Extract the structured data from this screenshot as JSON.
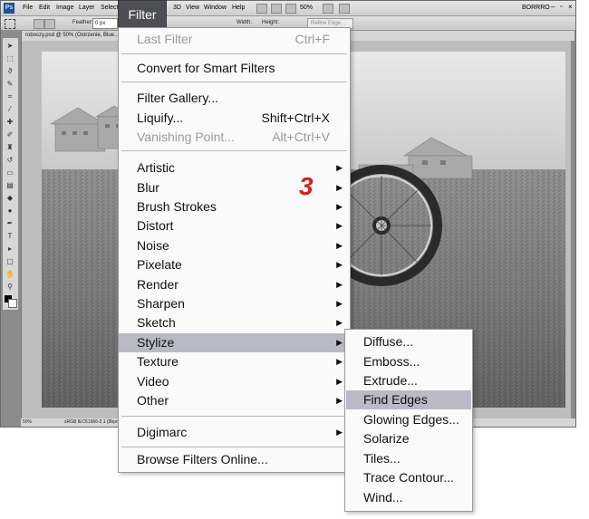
{
  "menubar": {
    "logo": "Ps",
    "items": [
      "File",
      "Edit",
      "Image",
      "Layer",
      "Select",
      "3D",
      "View",
      "Window",
      "Help"
    ],
    "zoom": "50%",
    "workspace": "BORRRO"
  },
  "options": {
    "feather_label": "Feather:",
    "feather_value": "0 px",
    "width_label": "Width:",
    "height_label": "Height:",
    "refine_edge": "Refine Edge..."
  },
  "document": {
    "tab_title": "roboczy.psd @ 50% (Ostrzenie, Blue..."
  },
  "status": {
    "zoom": "50%",
    "profile": "sRGB IEC61966-2.1 (8bpc)"
  },
  "filter_menu": {
    "title": "Filter",
    "last_filter": {
      "label": "Last Filter",
      "shortcut": "Ctrl+F"
    },
    "convert_smart": {
      "label": "Convert for Smart Filters"
    },
    "filter_gallery": {
      "label": "Filter Gallery..."
    },
    "liquify": {
      "label": "Liquify...",
      "shortcut": "Shift+Ctrl+X"
    },
    "vanishing_point": {
      "label": "Vanishing Point...",
      "shortcut": "Alt+Ctrl+V"
    },
    "submenus": [
      {
        "label": "Artistic"
      },
      {
        "label": "Blur"
      },
      {
        "label": "Brush Strokes"
      },
      {
        "label": "Distort"
      },
      {
        "label": "Noise"
      },
      {
        "label": "Pixelate"
      },
      {
        "label": "Render"
      },
      {
        "label": "Sharpen"
      },
      {
        "label": "Sketch"
      },
      {
        "label": "Stylize"
      },
      {
        "label": "Texture"
      },
      {
        "label": "Video"
      },
      {
        "label": "Other"
      }
    ],
    "digimarc": {
      "label": "Digimarc"
    },
    "browse_online": {
      "label": "Browse Filters Online..."
    }
  },
  "stylize_submenu": {
    "items": [
      "Diffuse...",
      "Emboss...",
      "Extrude...",
      "Find Edges",
      "Glowing Edges...",
      "Solarize",
      "Tiles...",
      "Trace Contour...",
      "Wind..."
    ]
  },
  "annotation": {
    "step": "3",
    "color": "#d91d1d"
  },
  "colors": {
    "menu_highlight": "#b9bac6",
    "filter_title_bg": "#4e4f55"
  }
}
